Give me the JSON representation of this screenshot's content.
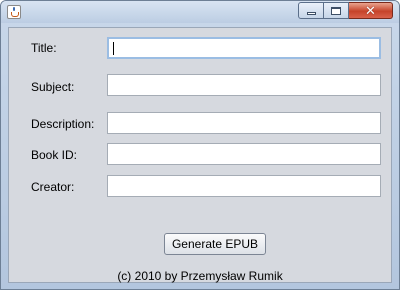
{
  "window": {
    "icon": "java-cup-icon",
    "controls": {
      "minimize": "minimize-icon",
      "maximize": "maximize-icon",
      "close": "close-icon"
    }
  },
  "form": {
    "fields": [
      {
        "label": "Title:",
        "value": ""
      },
      {
        "label": "Subject:",
        "value": ""
      },
      {
        "label": "Description:",
        "value": ""
      },
      {
        "label": "Book ID:",
        "value": ""
      },
      {
        "label": "Creator:",
        "value": ""
      }
    ],
    "generate_label": "Generate EPUB"
  },
  "footer": {
    "text": "(c) 2010 by Przemysław Rumik"
  },
  "colors": {
    "panel": "#d6d9df",
    "focus": "#9bbde3",
    "close": "#c6432a"
  }
}
